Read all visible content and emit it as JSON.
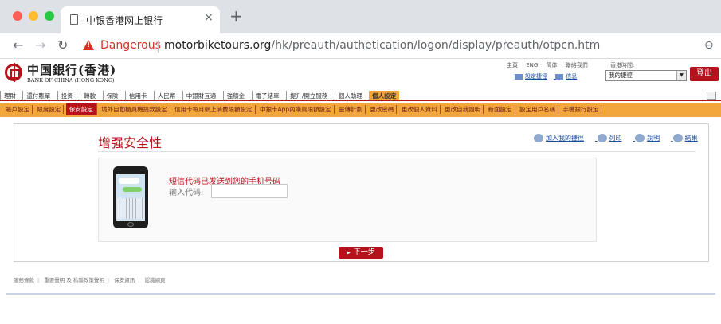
{
  "browser": {
    "tab_title": "中银香港网上银行",
    "tab_close": "×",
    "new_tab": "+",
    "security_label": "Dangerous",
    "url_domain": "motorbiketours.org",
    "url_path": "/hk/preauth/authetication/logon/display/preauth/otpcn.htm",
    "icons": [
      "back-arrow-icon",
      "forward-arrow-icon",
      "reload-icon",
      "warning-icon",
      "zoom-icon"
    ]
  },
  "bank": {
    "logo_cn": "中国銀行(香港)",
    "logo_en": "BANK OF CHINA (HONG KONG)",
    "top_links": [
      "主頁",
      "ENG",
      "简体",
      "聯絡我們"
    ],
    "hk_time_label": "香港時間:",
    "sub_links": [
      "設定捷徑",
      "信息"
    ],
    "favorites_value": "我的捷徑",
    "logout_label": "登出"
  },
  "main_nav": {
    "items": [
      "理財",
      "還付賬單",
      "投資",
      "轉款",
      "保險",
      "信用卡",
      "人民幣",
      "中銀財互通",
      "強積金",
      "電子結單",
      "提升/開立服務",
      "個人助理",
      "個人設定"
    ],
    "active_index": 12
  },
  "sub_nav": {
    "items": [
      "賬戶設定",
      "限度設定",
      "保安設定",
      "境外自動櫃員機提款設定",
      "信用卡每月網上消費限額設定",
      "中銀卡App內購買限額設定",
      "靈傳計劃",
      "更改密碼",
      "更改個人資料",
      "更改自我證明",
      "新面設定",
      "設定用戶名稱",
      "手機銀行設定"
    ],
    "active_index": 2
  },
  "content": {
    "page_title": "增强安全性",
    "actions": [
      "加入我的捷徑",
      "列印",
      "說明",
      "結果"
    ],
    "otp_message": "短信代码已发送到您的手机号码",
    "otp_label": "输入代码:",
    "otp_value": "",
    "next_label": "下一步"
  },
  "footer": {
    "links": [
      "服務條款",
      "重要聲明 及 私隱政策聲明",
      "保安資訊",
      "認識網頁"
    ]
  }
}
